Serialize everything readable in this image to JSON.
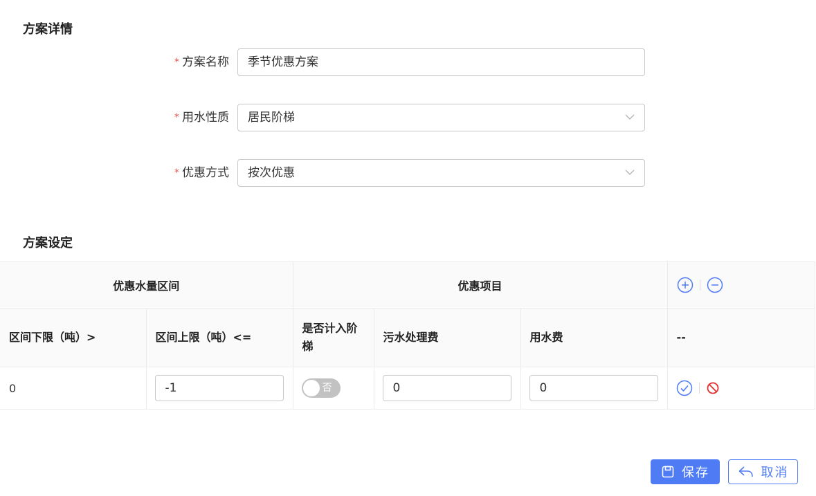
{
  "sections": {
    "details_title": "方案详情",
    "settings_title": "方案设定"
  },
  "form": {
    "required_mark": "*",
    "plan_name": {
      "label": "方案名称",
      "value": "季节优惠方案"
    },
    "water_nature": {
      "label": "用水性质",
      "value": "居民阶梯"
    },
    "discount_method": {
      "label": "优惠方式",
      "value": "按次优惠"
    }
  },
  "table": {
    "group_headers": {
      "range": "优惠水量区间",
      "items": "优惠项目"
    },
    "columns": {
      "lower": "区间下限（吨）>",
      "upper": "区间上限（吨）<=",
      "tiered": "是否计入阶梯",
      "sewage": "污水处理费",
      "water_fee": "用水费",
      "ops": "--"
    },
    "rows": [
      {
        "lower": "0",
        "upper": "-1",
        "tiered": "否",
        "tiered_on": false,
        "sewage": "0",
        "water_fee": "0"
      }
    ]
  },
  "buttons": {
    "save": "保存",
    "cancel": "取消"
  },
  "colors": {
    "primary": "#4f7cf5",
    "danger": "#e0302d",
    "required": "#e0524f",
    "switch_off": "#c2c2c2"
  }
}
